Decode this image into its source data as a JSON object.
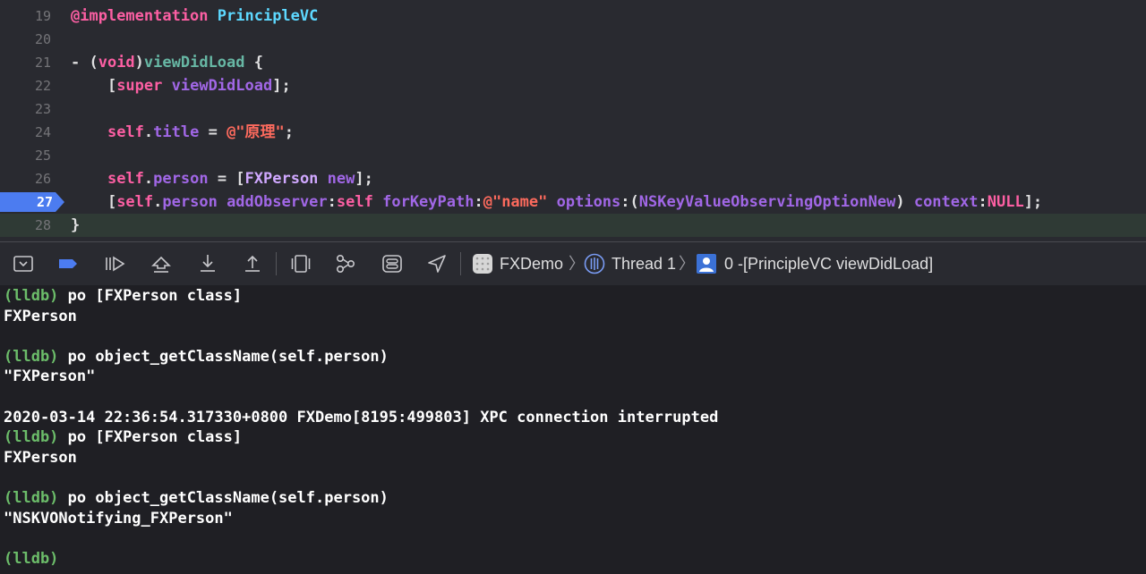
{
  "editor": {
    "current_line": "28",
    "breakpoint_line": "27",
    "lines": [
      {
        "num": "19",
        "t": [
          {
            "v": "@implementation",
            "c": "#fc5fa3"
          },
          {
            "v": " "
          },
          {
            "v": "PrincipleVC",
            "c": "#5dd8ff"
          }
        ]
      },
      {
        "num": "20",
        "t": []
      },
      {
        "num": "21",
        "t": [
          {
            "v": "- ("
          },
          {
            "v": "void",
            "c": "#fc5fa3"
          },
          {
            "v": ")"
          },
          {
            "v": "viewDidLoad",
            "c": "#67b7a4"
          },
          {
            "v": " {"
          }
        ]
      },
      {
        "num": "22",
        "t": [
          {
            "v": "    ["
          },
          {
            "v": "super",
            "c": "#fc5fa3"
          },
          {
            "v": " "
          },
          {
            "v": "viewDidLoad",
            "c": "#a167e6"
          },
          {
            "v": "];"
          }
        ]
      },
      {
        "num": "23",
        "t": []
      },
      {
        "num": "24",
        "t": [
          {
            "v": "    "
          },
          {
            "v": "self",
            "c": "#fc5fa3"
          },
          {
            "v": "."
          },
          {
            "v": "title",
            "c": "#a167e6"
          },
          {
            "v": " = "
          },
          {
            "v": "@\"原理\"",
            "c": "#fc6a5d"
          },
          {
            "v": ";"
          }
        ]
      },
      {
        "num": "25",
        "t": []
      },
      {
        "num": "26",
        "t": [
          {
            "v": "    "
          },
          {
            "v": "self",
            "c": "#fc5fa3"
          },
          {
            "v": "."
          },
          {
            "v": "person",
            "c": "#a167e6"
          },
          {
            "v": " = ["
          },
          {
            "v": "FXPerson",
            "c": "#d0a8ff"
          },
          {
            "v": " "
          },
          {
            "v": "new",
            "c": "#a167e6"
          },
          {
            "v": "];"
          }
        ]
      },
      {
        "num": "27",
        "t": [
          {
            "v": "    ["
          },
          {
            "v": "self",
            "c": "#fc5fa3"
          },
          {
            "v": "."
          },
          {
            "v": "person",
            "c": "#a167e6"
          },
          {
            "v": " "
          },
          {
            "v": "addObserver",
            "c": "#a167e6"
          },
          {
            "v": ":"
          },
          {
            "v": "self",
            "c": "#fc5fa3"
          },
          {
            "v": " "
          },
          {
            "v": "forKeyPath",
            "c": "#a167e6"
          },
          {
            "v": ":"
          },
          {
            "v": "@\"name\"",
            "c": "#fc6a5d"
          },
          {
            "v": " "
          },
          {
            "v": "options",
            "c": "#a167e6"
          },
          {
            "v": ":("
          },
          {
            "v": "NSKeyValueObservingOptionNew",
            "c": "#a167e6"
          },
          {
            "v": ") "
          },
          {
            "v": "context",
            "c": "#a167e6"
          },
          {
            "v": ":"
          },
          {
            "v": "NULL",
            "c": "#fc5fa3"
          },
          {
            "v": "];"
          }
        ]
      },
      {
        "num": "28",
        "t": [
          {
            "v": "}"
          }
        ]
      }
    ]
  },
  "debug_bar": {
    "buttons": [
      {
        "name": "hide-debug-area-button",
        "icon": "panel-collapse-icon"
      },
      {
        "name": "breakpoints-toggle-button",
        "icon": "breakpoint-icon"
      },
      {
        "name": "continue-button",
        "icon": "continue-icon"
      },
      {
        "name": "step-over-button",
        "icon": "step-over-icon"
      },
      {
        "name": "step-into-button",
        "icon": "step-into-icon"
      },
      {
        "name": "step-out-button",
        "icon": "step-out-icon"
      },
      {
        "name": "view-debugger-button",
        "icon": "view-hierarchy-icon"
      },
      {
        "name": "memory-graph-button",
        "icon": "memory-graph-icon"
      },
      {
        "name": "environment-overrides-button",
        "icon": "toggle-switches-icon"
      },
      {
        "name": "simulate-location-button",
        "icon": "location-arrow-icon"
      }
    ],
    "app_name": "FXDemo",
    "thread": "Thread 1",
    "frame": "0 -[PrincipleVC viewDidLoad]",
    "colors": {
      "breakpoint": "#4c7cf0",
      "thread_icon": "#7a9cf5",
      "frame_icon": "#3b71d6"
    }
  },
  "console": {
    "prompt": "(lldb)",
    "lines": [
      {
        "p": true,
        "t": " po [FXPerson class]"
      },
      {
        "t": "FXPerson"
      },
      {
        "t": ""
      },
      {
        "p": true,
        "t": " po object_getClassName(self.person)"
      },
      {
        "t": "\"FXPerson\""
      },
      {
        "t": ""
      },
      {
        "t": "2020-03-14 22:36:54.317330+0800 FXDemo[8195:499803] XPC connection interrupted"
      },
      {
        "p": true,
        "t": " po [FXPerson class]"
      },
      {
        "t": "FXPerson"
      },
      {
        "t": ""
      },
      {
        "p": true,
        "t": " po object_getClassName(self.person)"
      },
      {
        "t": "\"NSKVONotifying_FXPerson\""
      },
      {
        "t": ""
      },
      {
        "p": true,
        "t": ""
      }
    ]
  }
}
